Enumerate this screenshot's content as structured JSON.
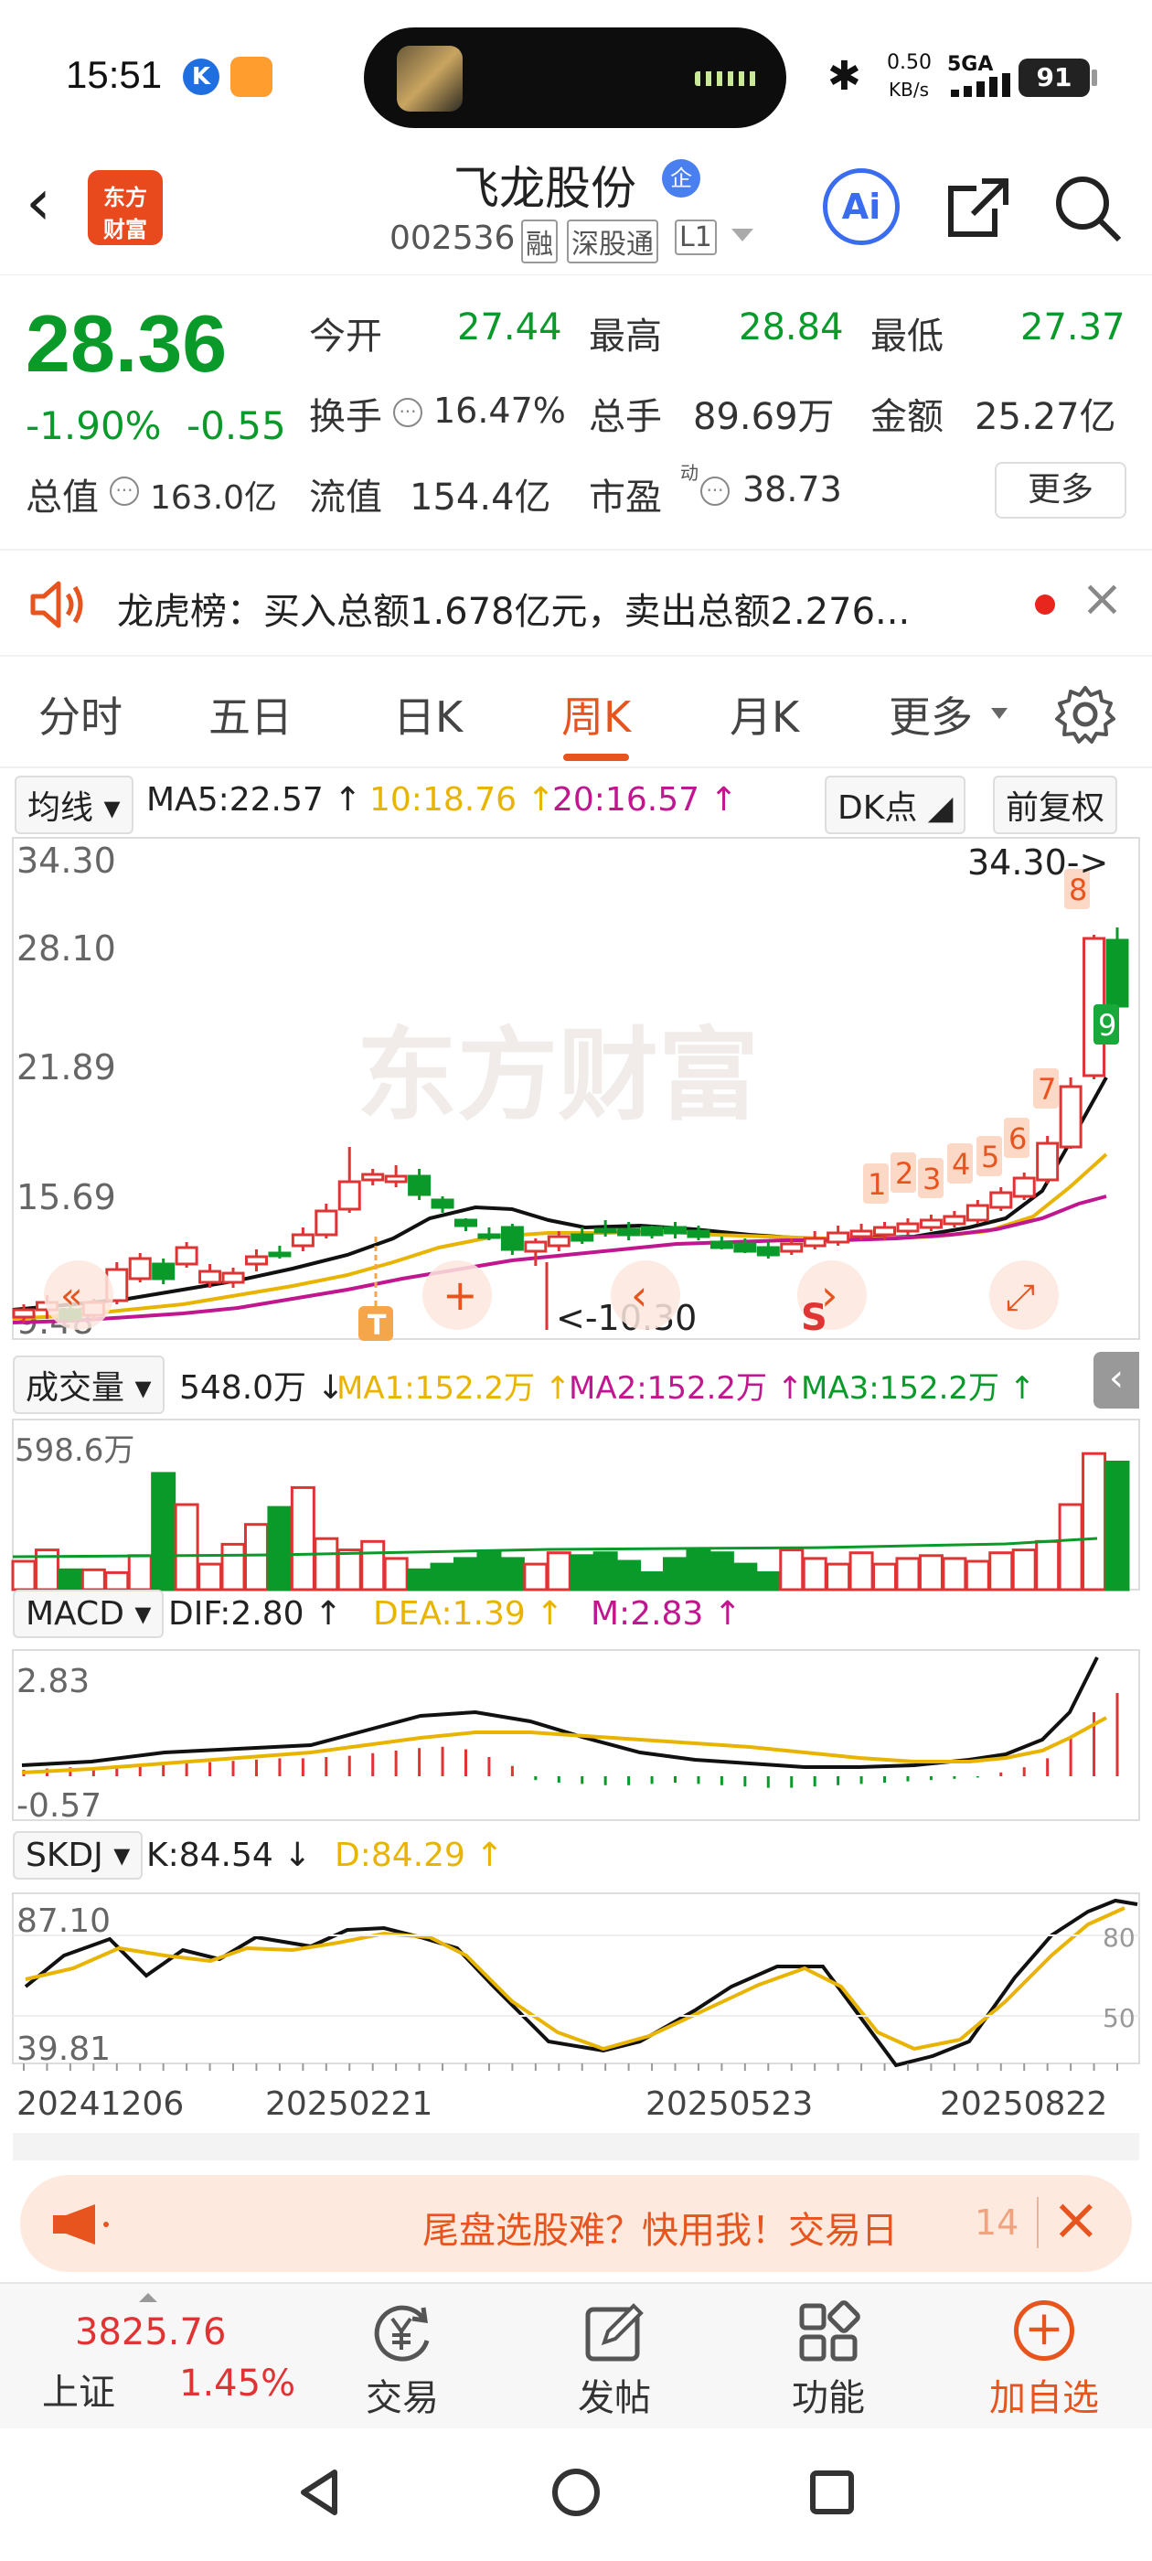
{
  "status": {
    "time": "15:51",
    "net_speed_value": "0.50",
    "net_speed_unit": "KB/s",
    "network": "5GA",
    "battery": "91"
  },
  "header": {
    "stock_name": "飞龙股份",
    "qi_badge": "企",
    "code": "002536",
    "tag_rong": "融",
    "tag_sgt": "深股通",
    "tag_level": "L1",
    "logo_line1": "东方",
    "logo_line2": "财富",
    "ai_label": "Ai"
  },
  "quote": {
    "price": "28.36",
    "change_pct": "-1.90%",
    "change": "-0.55",
    "open_label": "今开",
    "open": "27.44",
    "high_label": "最高",
    "high": "28.84",
    "low_label": "最低",
    "low": "27.37",
    "turnover_label": "换手",
    "turnover": "16.47%",
    "volume_label": "总手",
    "volume": "89.69万",
    "amount_label": "金额",
    "amount": "25.27亿",
    "mktcap_label": "总值",
    "mktcap": "163.0亿",
    "float_label": "流值",
    "float": "154.4亿",
    "pe_label": "市盈",
    "pe_sup": "动",
    "pe": "38.73",
    "more": "更多"
  },
  "lhb": {
    "text": "龙虎榜：买入总额1.678亿元，卖出总额2.276..."
  },
  "tabs": [
    "分时",
    "五日",
    "日K",
    "周K",
    "月K",
    "更多"
  ],
  "active_tab": "周K",
  "kline": {
    "indicator": "均线",
    "ma5": "MA5:22.57",
    "ma10": "10:18.76",
    "ma20": "20:16.57",
    "dk_btn": "DK点",
    "fq_btn": "前复权",
    "watermark": "东方财富",
    "y_labels": [
      "34.30",
      "28.10",
      "21.89",
      "15.69",
      "9.48"
    ],
    "max_marker": "34.30->",
    "min_marker": "<-10.30",
    "t_marker": "T",
    "s_marker": "S",
    "seq_labels": [
      "1",
      "2",
      "3",
      "4",
      "5",
      "6",
      "7",
      "8",
      "9"
    ]
  },
  "volume": {
    "indicator": "成交量",
    "value": "548.0万",
    "ma1": "MA1:152.2万",
    "ma2": "MA2:152.2万",
    "ma3": "MA3:152.2万",
    "y_top": "598.6万"
  },
  "macd": {
    "indicator": "MACD",
    "dif": "DIF:2.80",
    "dea": "DEA:1.39",
    "m": "M:2.83",
    "y_top": "2.83",
    "y_bottom": "-0.57"
  },
  "skdj": {
    "indicator": "SKDJ",
    "k": "K:84.54",
    "d": "D:84.29",
    "y_top": "87.10",
    "y_bottom": "39.81",
    "r80": "80",
    "r50": "50"
  },
  "x_dates": [
    "20241206",
    "20250221",
    "20250523",
    "20250822"
  ],
  "banner": {
    "text": "尾盘选股难？快用我！交易日",
    "counter": "14"
  },
  "bottomnav": {
    "index_value": "3825.76",
    "index_name": "上证",
    "index_pct": "1.45%",
    "trade": "交易",
    "post": "发帖",
    "func": "功能",
    "add": "加自选"
  },
  "colors": {
    "up": "#e03333",
    "down": "#0a9a2a",
    "ma10": "#e8b400",
    "ma20": "#c0168f",
    "accent": "#e8541e"
  }
}
